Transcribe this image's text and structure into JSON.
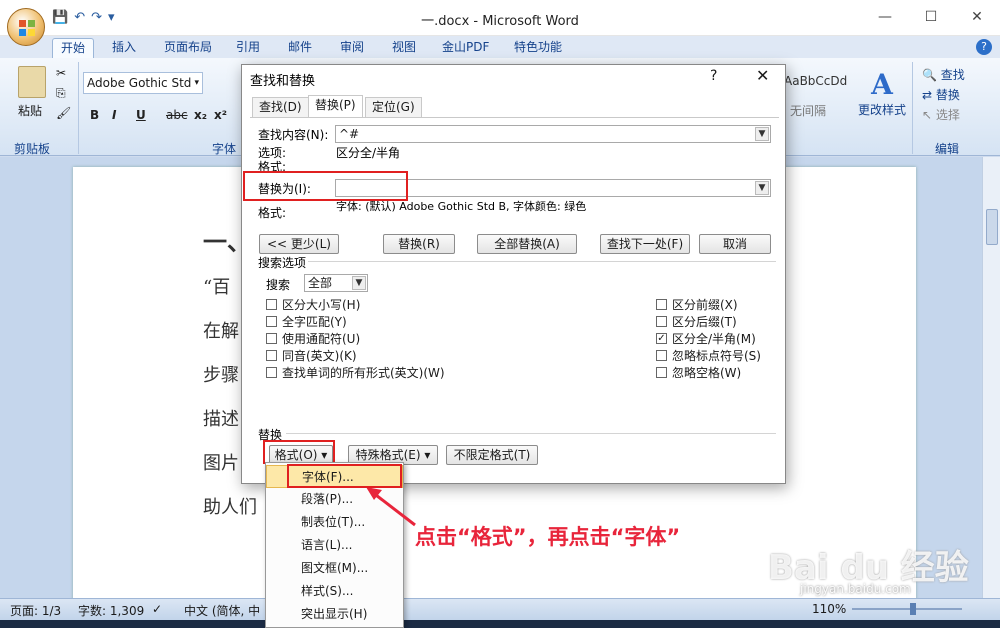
{
  "window": {
    "title": "一.docx - Microsoft Word",
    "controls": [
      "—",
      "☐",
      "✕"
    ]
  },
  "ribbon": {
    "tabs": [
      "开始",
      "插入",
      "页面布局",
      "引用",
      "邮件",
      "审阅",
      "视图",
      "金山PDF",
      "特色功能"
    ],
    "active_tab": "开始",
    "font_name": "Adobe Gothic Std",
    "groups": {
      "clipboard": "剪贴板",
      "font": "字体",
      "editing": "编辑"
    },
    "paste_label": "粘贴",
    "format_buttons": [
      "B",
      "I",
      "U",
      "abc",
      "x₂",
      "x²"
    ],
    "styles": {
      "preview1": "AaBbCcDd",
      "preview2": "无间隔",
      "change_styles": "更改样式"
    },
    "editing": {
      "find": "查找",
      "replace": "替换",
      "select": "选择"
    }
  },
  "document": {
    "lines": [
      "“百",
      "在解",
      "步骤",
      "描述",
      "图片",
      "助人们"
    ],
    "heading_fragment": "一、"
  },
  "statusbar": {
    "page": "页面: 1/3",
    "words": "字数: 1,309",
    "language": "中文 (简体, 中",
    "zoom": "110%"
  },
  "dialog": {
    "title": "查找和替换",
    "help": "?",
    "close": "✕",
    "tabs": [
      "查找(D)",
      "替换(P)",
      "定位(G)"
    ],
    "active_tab": "替换(P)",
    "find_label": "查找内容(N):",
    "find_value": "^#",
    "options_label": "选项:",
    "options_value": "区分全/半角",
    "format_label1": "格式:",
    "replace_label": "替换为(I):",
    "replace_value": "",
    "format_label2": "格式:",
    "replace_format_value": "字体: (默认) Adobe Gothic Std B, 字体颜色: 绿色",
    "buttons": {
      "less": "<< 更少(L)",
      "replace": "替换(R)",
      "replace_all": "全部替换(A)",
      "find_next": "查找下一处(F)",
      "cancel": "取消"
    },
    "search_options_title": "搜索选项",
    "search_label": "搜索",
    "search_value": "全部",
    "left_checks": [
      {
        "label": "区分大小写(H)",
        "checked": false
      },
      {
        "label": "全字匹配(Y)",
        "checked": false
      },
      {
        "label": "使用通配符(U)",
        "checked": false
      },
      {
        "label": "同音(英文)(K)",
        "checked": false
      },
      {
        "label": "查找单词的所有形式(英文)(W)",
        "checked": false
      }
    ],
    "right_checks": [
      {
        "label": "区分前缀(X)",
        "checked": false
      },
      {
        "label": "区分后缀(T)",
        "checked": false
      },
      {
        "label": "区分全/半角(M)",
        "checked": true
      },
      {
        "label": "忽略标点符号(S)",
        "checked": false
      },
      {
        "label": "忽略空格(W)",
        "checked": false
      }
    ],
    "replace_section_title": "替换",
    "bottom_buttons": {
      "format": "格式(O) ▾",
      "special": "特殊格式(E) ▾",
      "no_format": "不限定格式(T)"
    }
  },
  "format_menu": {
    "items": [
      "字体(F)...",
      "段落(P)...",
      "制表位(T)...",
      "语言(L)...",
      "图文框(M)...",
      "样式(S)...",
      "突出显示(H)"
    ],
    "highlighted": 0
  },
  "annotation": "点击“格式”，再点击“字体”",
  "watermark": {
    "main": "Bai du 经验",
    "sub": "jingyan.baidu.com"
  },
  "colors": {
    "annotation_red": "#e8253b",
    "ribbon_blue": "#15428b",
    "highlight": "#fde8a8"
  }
}
